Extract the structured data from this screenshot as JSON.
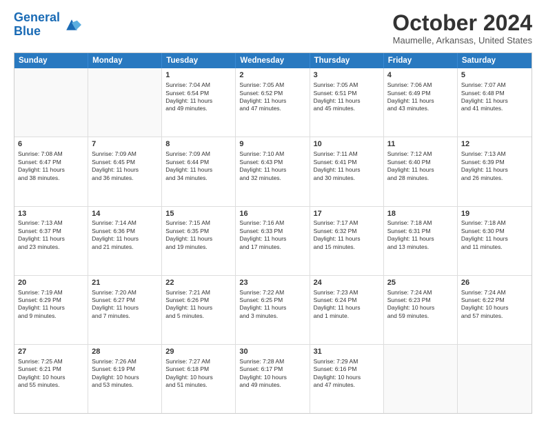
{
  "header": {
    "logo_line1": "General",
    "logo_line2": "Blue",
    "month": "October 2024",
    "location": "Maumelle, Arkansas, United States"
  },
  "weekdays": [
    "Sunday",
    "Monday",
    "Tuesday",
    "Wednesday",
    "Thursday",
    "Friday",
    "Saturday"
  ],
  "rows": [
    [
      {
        "day": "",
        "sunrise": "",
        "sunset": "",
        "daylight": "",
        "empty": true
      },
      {
        "day": "",
        "sunrise": "",
        "sunset": "",
        "daylight": "",
        "empty": true
      },
      {
        "day": "1",
        "sunrise": "Sunrise: 7:04 AM",
        "sunset": "Sunset: 6:54 PM",
        "daylight": "Daylight: 11 hours and 49 minutes.",
        "empty": false
      },
      {
        "day": "2",
        "sunrise": "Sunrise: 7:05 AM",
        "sunset": "Sunset: 6:52 PM",
        "daylight": "Daylight: 11 hours and 47 minutes.",
        "empty": false
      },
      {
        "day": "3",
        "sunrise": "Sunrise: 7:05 AM",
        "sunset": "Sunset: 6:51 PM",
        "daylight": "Daylight: 11 hours and 45 minutes.",
        "empty": false
      },
      {
        "day": "4",
        "sunrise": "Sunrise: 7:06 AM",
        "sunset": "Sunset: 6:49 PM",
        "daylight": "Daylight: 11 hours and 43 minutes.",
        "empty": false
      },
      {
        "day": "5",
        "sunrise": "Sunrise: 7:07 AM",
        "sunset": "Sunset: 6:48 PM",
        "daylight": "Daylight: 11 hours and 41 minutes.",
        "empty": false
      }
    ],
    [
      {
        "day": "6",
        "sunrise": "Sunrise: 7:08 AM",
        "sunset": "Sunset: 6:47 PM",
        "daylight": "Daylight: 11 hours and 38 minutes.",
        "empty": false
      },
      {
        "day": "7",
        "sunrise": "Sunrise: 7:09 AM",
        "sunset": "Sunset: 6:45 PM",
        "daylight": "Daylight: 11 hours and 36 minutes.",
        "empty": false
      },
      {
        "day": "8",
        "sunrise": "Sunrise: 7:09 AM",
        "sunset": "Sunset: 6:44 PM",
        "daylight": "Daylight: 11 hours and 34 minutes.",
        "empty": false
      },
      {
        "day": "9",
        "sunrise": "Sunrise: 7:10 AM",
        "sunset": "Sunset: 6:43 PM",
        "daylight": "Daylight: 11 hours and 32 minutes.",
        "empty": false
      },
      {
        "day": "10",
        "sunrise": "Sunrise: 7:11 AM",
        "sunset": "Sunset: 6:41 PM",
        "daylight": "Daylight: 11 hours and 30 minutes.",
        "empty": false
      },
      {
        "day": "11",
        "sunrise": "Sunrise: 7:12 AM",
        "sunset": "Sunset: 6:40 PM",
        "daylight": "Daylight: 11 hours and 28 minutes.",
        "empty": false
      },
      {
        "day": "12",
        "sunrise": "Sunrise: 7:13 AM",
        "sunset": "Sunset: 6:39 PM",
        "daylight": "Daylight: 11 hours and 26 minutes.",
        "empty": false
      }
    ],
    [
      {
        "day": "13",
        "sunrise": "Sunrise: 7:13 AM",
        "sunset": "Sunset: 6:37 PM",
        "daylight": "Daylight: 11 hours and 23 minutes.",
        "empty": false
      },
      {
        "day": "14",
        "sunrise": "Sunrise: 7:14 AM",
        "sunset": "Sunset: 6:36 PM",
        "daylight": "Daylight: 11 hours and 21 minutes.",
        "empty": false
      },
      {
        "day": "15",
        "sunrise": "Sunrise: 7:15 AM",
        "sunset": "Sunset: 6:35 PM",
        "daylight": "Daylight: 11 hours and 19 minutes.",
        "empty": false
      },
      {
        "day": "16",
        "sunrise": "Sunrise: 7:16 AM",
        "sunset": "Sunset: 6:33 PM",
        "daylight": "Daylight: 11 hours and 17 minutes.",
        "empty": false
      },
      {
        "day": "17",
        "sunrise": "Sunrise: 7:17 AM",
        "sunset": "Sunset: 6:32 PM",
        "daylight": "Daylight: 11 hours and 15 minutes.",
        "empty": false
      },
      {
        "day": "18",
        "sunrise": "Sunrise: 7:18 AM",
        "sunset": "Sunset: 6:31 PM",
        "daylight": "Daylight: 11 hours and 13 minutes.",
        "empty": false
      },
      {
        "day": "19",
        "sunrise": "Sunrise: 7:18 AM",
        "sunset": "Sunset: 6:30 PM",
        "daylight": "Daylight: 11 hours and 11 minutes.",
        "empty": false
      }
    ],
    [
      {
        "day": "20",
        "sunrise": "Sunrise: 7:19 AM",
        "sunset": "Sunset: 6:29 PM",
        "daylight": "Daylight: 11 hours and 9 minutes.",
        "empty": false
      },
      {
        "day": "21",
        "sunrise": "Sunrise: 7:20 AM",
        "sunset": "Sunset: 6:27 PM",
        "daylight": "Daylight: 11 hours and 7 minutes.",
        "empty": false
      },
      {
        "day": "22",
        "sunrise": "Sunrise: 7:21 AM",
        "sunset": "Sunset: 6:26 PM",
        "daylight": "Daylight: 11 hours and 5 minutes.",
        "empty": false
      },
      {
        "day": "23",
        "sunrise": "Sunrise: 7:22 AM",
        "sunset": "Sunset: 6:25 PM",
        "daylight": "Daylight: 11 hours and 3 minutes.",
        "empty": false
      },
      {
        "day": "24",
        "sunrise": "Sunrise: 7:23 AM",
        "sunset": "Sunset: 6:24 PM",
        "daylight": "Daylight: 11 hours and 1 minute.",
        "empty": false
      },
      {
        "day": "25",
        "sunrise": "Sunrise: 7:24 AM",
        "sunset": "Sunset: 6:23 PM",
        "daylight": "Daylight: 10 hours and 59 minutes.",
        "empty": false
      },
      {
        "day": "26",
        "sunrise": "Sunrise: 7:24 AM",
        "sunset": "Sunset: 6:22 PM",
        "daylight": "Daylight: 10 hours and 57 minutes.",
        "empty": false
      }
    ],
    [
      {
        "day": "27",
        "sunrise": "Sunrise: 7:25 AM",
        "sunset": "Sunset: 6:21 PM",
        "daylight": "Daylight: 10 hours and 55 minutes.",
        "empty": false
      },
      {
        "day": "28",
        "sunrise": "Sunrise: 7:26 AM",
        "sunset": "Sunset: 6:19 PM",
        "daylight": "Daylight: 10 hours and 53 minutes.",
        "empty": false
      },
      {
        "day": "29",
        "sunrise": "Sunrise: 7:27 AM",
        "sunset": "Sunset: 6:18 PM",
        "daylight": "Daylight: 10 hours and 51 minutes.",
        "empty": false
      },
      {
        "day": "30",
        "sunrise": "Sunrise: 7:28 AM",
        "sunset": "Sunset: 6:17 PM",
        "daylight": "Daylight: 10 hours and 49 minutes.",
        "empty": false
      },
      {
        "day": "31",
        "sunrise": "Sunrise: 7:29 AM",
        "sunset": "Sunset: 6:16 PM",
        "daylight": "Daylight: 10 hours and 47 minutes.",
        "empty": false
      },
      {
        "day": "",
        "sunrise": "",
        "sunset": "",
        "daylight": "",
        "empty": true
      },
      {
        "day": "",
        "sunrise": "",
        "sunset": "",
        "daylight": "",
        "empty": true
      }
    ]
  ]
}
